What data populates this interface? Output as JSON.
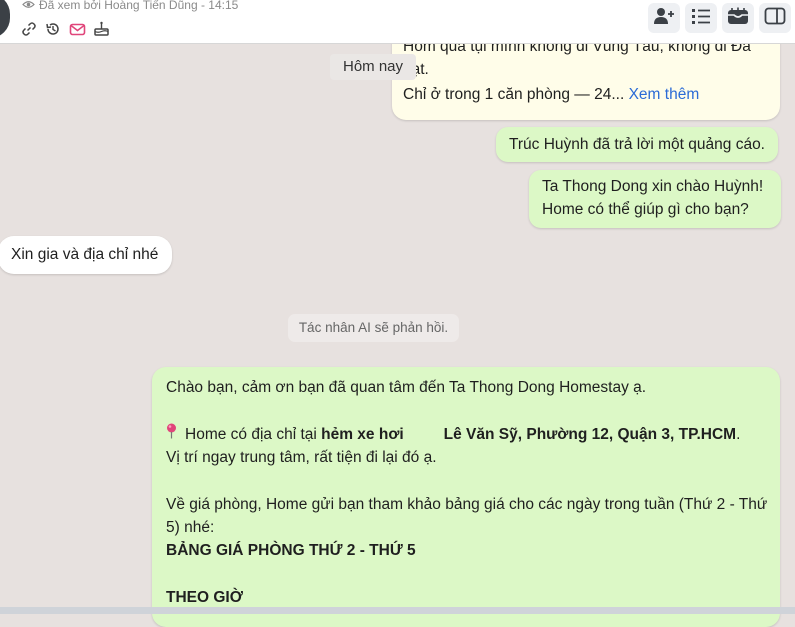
{
  "header": {
    "seen_text": "Đã xem bởi Hoàng Tiến Dũng - 14:15",
    "tools": [
      "link-icon",
      "history-icon",
      "mail-icon",
      "cake-icon"
    ],
    "buttons": [
      "add-user-icon",
      "list-icon",
      "inbox-icon",
      "sidebar-icon"
    ]
  },
  "chat": {
    "ad": {
      "line1": "Hôm qua tụi mình không đi Vũng Tàu, không đi Đà",
      "line2": "Lạt.",
      "line3": "Chỉ ở trong 1 căn phòng — 24...",
      "more": "Xem thêm"
    },
    "date_divider": "Hôm nay",
    "reply_notice": "Trúc Huỳnh đã trả lời một quảng cáo.",
    "greeting": {
      "line1": "Ta Thong Dong xin chào Huỳnh!",
      "line2": "Home có thể giúp gì cho bạn?"
    },
    "customer_question": "Xin gia và địa chỉ nhé",
    "system_note": "Tác nhân AI sẽ phản hồi.",
    "ai_reply": {
      "line1": "Chào bạn, cảm ơn bạn đã quan tâm đến Ta Thong Dong Homestay ạ.",
      "addr_prefix": "Home có địa chỉ tại",
      "addr_bold1": "hẻm xe hơi",
      "addr_bold2": "Lê Văn Sỹ, Phường 12, Quận 3, TP.HCM",
      "addr_suffix": ".",
      "line3": "Vị trí ngay trung tâm, rất tiện đi lại đó ạ.",
      "line4": "Về giá phòng, Home gửi bạn tham khảo bảng giá cho các ngày trong tuần (Thứ 2 - Thứ",
      "line5": "5) nhé:",
      "line6": "BẢNG GIÁ PHÒNG THỨ 2 - THỨ 5",
      "line7": "THEO GIỜ"
    }
  },
  "colors": {
    "background": "#e7e1df",
    "outgoing_bubble": "#dcf8c6",
    "incoming_bubble": "#ffffff",
    "link": "#2b6bd6"
  }
}
